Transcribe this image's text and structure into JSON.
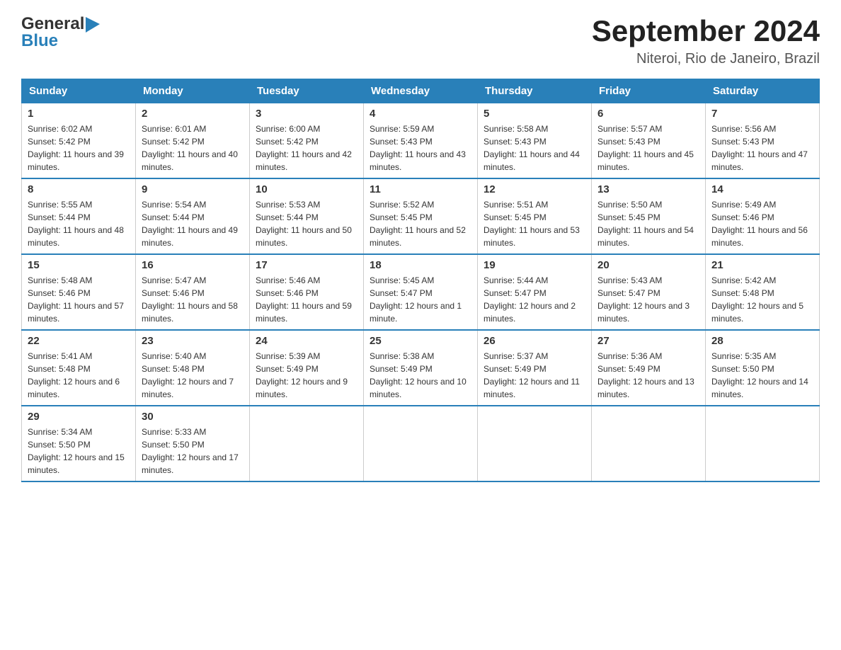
{
  "header": {
    "logo": {
      "general": "General",
      "blue": "Blue"
    },
    "title": "September 2024",
    "subtitle": "Niteroi, Rio de Janeiro, Brazil"
  },
  "days_of_week": [
    "Sunday",
    "Monday",
    "Tuesday",
    "Wednesday",
    "Thursday",
    "Friday",
    "Saturday"
  ],
  "weeks": [
    [
      {
        "date": "1",
        "sunrise": "6:02 AM",
        "sunset": "5:42 PM",
        "daylight": "11 hours and 39 minutes."
      },
      {
        "date": "2",
        "sunrise": "6:01 AM",
        "sunset": "5:42 PM",
        "daylight": "11 hours and 40 minutes."
      },
      {
        "date": "3",
        "sunrise": "6:00 AM",
        "sunset": "5:42 PM",
        "daylight": "11 hours and 42 minutes."
      },
      {
        "date": "4",
        "sunrise": "5:59 AM",
        "sunset": "5:43 PM",
        "daylight": "11 hours and 43 minutes."
      },
      {
        "date": "5",
        "sunrise": "5:58 AM",
        "sunset": "5:43 PM",
        "daylight": "11 hours and 44 minutes."
      },
      {
        "date": "6",
        "sunrise": "5:57 AM",
        "sunset": "5:43 PM",
        "daylight": "11 hours and 45 minutes."
      },
      {
        "date": "7",
        "sunrise": "5:56 AM",
        "sunset": "5:43 PM",
        "daylight": "11 hours and 47 minutes."
      }
    ],
    [
      {
        "date": "8",
        "sunrise": "5:55 AM",
        "sunset": "5:44 PM",
        "daylight": "11 hours and 48 minutes."
      },
      {
        "date": "9",
        "sunrise": "5:54 AM",
        "sunset": "5:44 PM",
        "daylight": "11 hours and 49 minutes."
      },
      {
        "date": "10",
        "sunrise": "5:53 AM",
        "sunset": "5:44 PM",
        "daylight": "11 hours and 50 minutes."
      },
      {
        "date": "11",
        "sunrise": "5:52 AM",
        "sunset": "5:45 PM",
        "daylight": "11 hours and 52 minutes."
      },
      {
        "date": "12",
        "sunrise": "5:51 AM",
        "sunset": "5:45 PM",
        "daylight": "11 hours and 53 minutes."
      },
      {
        "date": "13",
        "sunrise": "5:50 AM",
        "sunset": "5:45 PM",
        "daylight": "11 hours and 54 minutes."
      },
      {
        "date": "14",
        "sunrise": "5:49 AM",
        "sunset": "5:46 PM",
        "daylight": "11 hours and 56 minutes."
      }
    ],
    [
      {
        "date": "15",
        "sunrise": "5:48 AM",
        "sunset": "5:46 PM",
        "daylight": "11 hours and 57 minutes."
      },
      {
        "date": "16",
        "sunrise": "5:47 AM",
        "sunset": "5:46 PM",
        "daylight": "11 hours and 58 minutes."
      },
      {
        "date": "17",
        "sunrise": "5:46 AM",
        "sunset": "5:46 PM",
        "daylight": "11 hours and 59 minutes."
      },
      {
        "date": "18",
        "sunrise": "5:45 AM",
        "sunset": "5:47 PM",
        "daylight": "12 hours and 1 minute."
      },
      {
        "date": "19",
        "sunrise": "5:44 AM",
        "sunset": "5:47 PM",
        "daylight": "12 hours and 2 minutes."
      },
      {
        "date": "20",
        "sunrise": "5:43 AM",
        "sunset": "5:47 PM",
        "daylight": "12 hours and 3 minutes."
      },
      {
        "date": "21",
        "sunrise": "5:42 AM",
        "sunset": "5:48 PM",
        "daylight": "12 hours and 5 minutes."
      }
    ],
    [
      {
        "date": "22",
        "sunrise": "5:41 AM",
        "sunset": "5:48 PM",
        "daylight": "12 hours and 6 minutes."
      },
      {
        "date": "23",
        "sunrise": "5:40 AM",
        "sunset": "5:48 PM",
        "daylight": "12 hours and 7 minutes."
      },
      {
        "date": "24",
        "sunrise": "5:39 AM",
        "sunset": "5:49 PM",
        "daylight": "12 hours and 9 minutes."
      },
      {
        "date": "25",
        "sunrise": "5:38 AM",
        "sunset": "5:49 PM",
        "daylight": "12 hours and 10 minutes."
      },
      {
        "date": "26",
        "sunrise": "5:37 AM",
        "sunset": "5:49 PM",
        "daylight": "12 hours and 11 minutes."
      },
      {
        "date": "27",
        "sunrise": "5:36 AM",
        "sunset": "5:49 PM",
        "daylight": "12 hours and 13 minutes."
      },
      {
        "date": "28",
        "sunrise": "5:35 AM",
        "sunset": "5:50 PM",
        "daylight": "12 hours and 14 minutes."
      }
    ],
    [
      {
        "date": "29",
        "sunrise": "5:34 AM",
        "sunset": "5:50 PM",
        "daylight": "12 hours and 15 minutes."
      },
      {
        "date": "30",
        "sunrise": "5:33 AM",
        "sunset": "5:50 PM",
        "daylight": "12 hours and 17 minutes."
      },
      null,
      null,
      null,
      null,
      null
    ]
  ],
  "labels": {
    "sunrise": "Sunrise:",
    "sunset": "Sunset:",
    "daylight": "Daylight:"
  }
}
